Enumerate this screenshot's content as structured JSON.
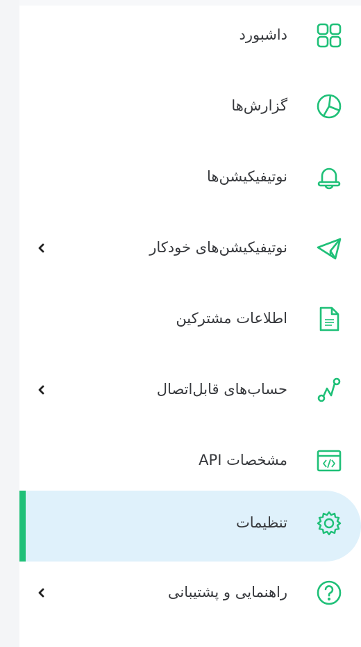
{
  "sidebar": {
    "accent_color": "#1fc078",
    "active_bg": "#dff1fb",
    "items": [
      {
        "label": "داشبورد",
        "icon": "grid-icon",
        "has_submenu": false,
        "active": false
      },
      {
        "label": "گزارش‌ها",
        "icon": "pie-chart-icon",
        "has_submenu": false,
        "active": false
      },
      {
        "label": "نوتیفیکیشن‌ها",
        "icon": "bell-icon",
        "has_submenu": false,
        "active": false
      },
      {
        "label": "نوتیفیکیشن‌های خودکار",
        "icon": "paper-plane-icon",
        "has_submenu": true,
        "active": false
      },
      {
        "label": "اطلاعات مشترکین",
        "icon": "document-icon",
        "has_submenu": false,
        "active": false
      },
      {
        "label": "حساب‌های قابل‌اتصال",
        "icon": "connection-nodes-icon",
        "has_submenu": true,
        "active": false
      },
      {
        "label": "مشخصات API",
        "icon": "code-window-icon",
        "has_submenu": false,
        "active": false
      },
      {
        "label": "تنظیمات",
        "icon": "gear-icon",
        "has_submenu": false,
        "active": true
      },
      {
        "label": "راهنمایی و پشتیبانی",
        "icon": "help-circle-icon",
        "has_submenu": true,
        "active": false
      }
    ]
  }
}
